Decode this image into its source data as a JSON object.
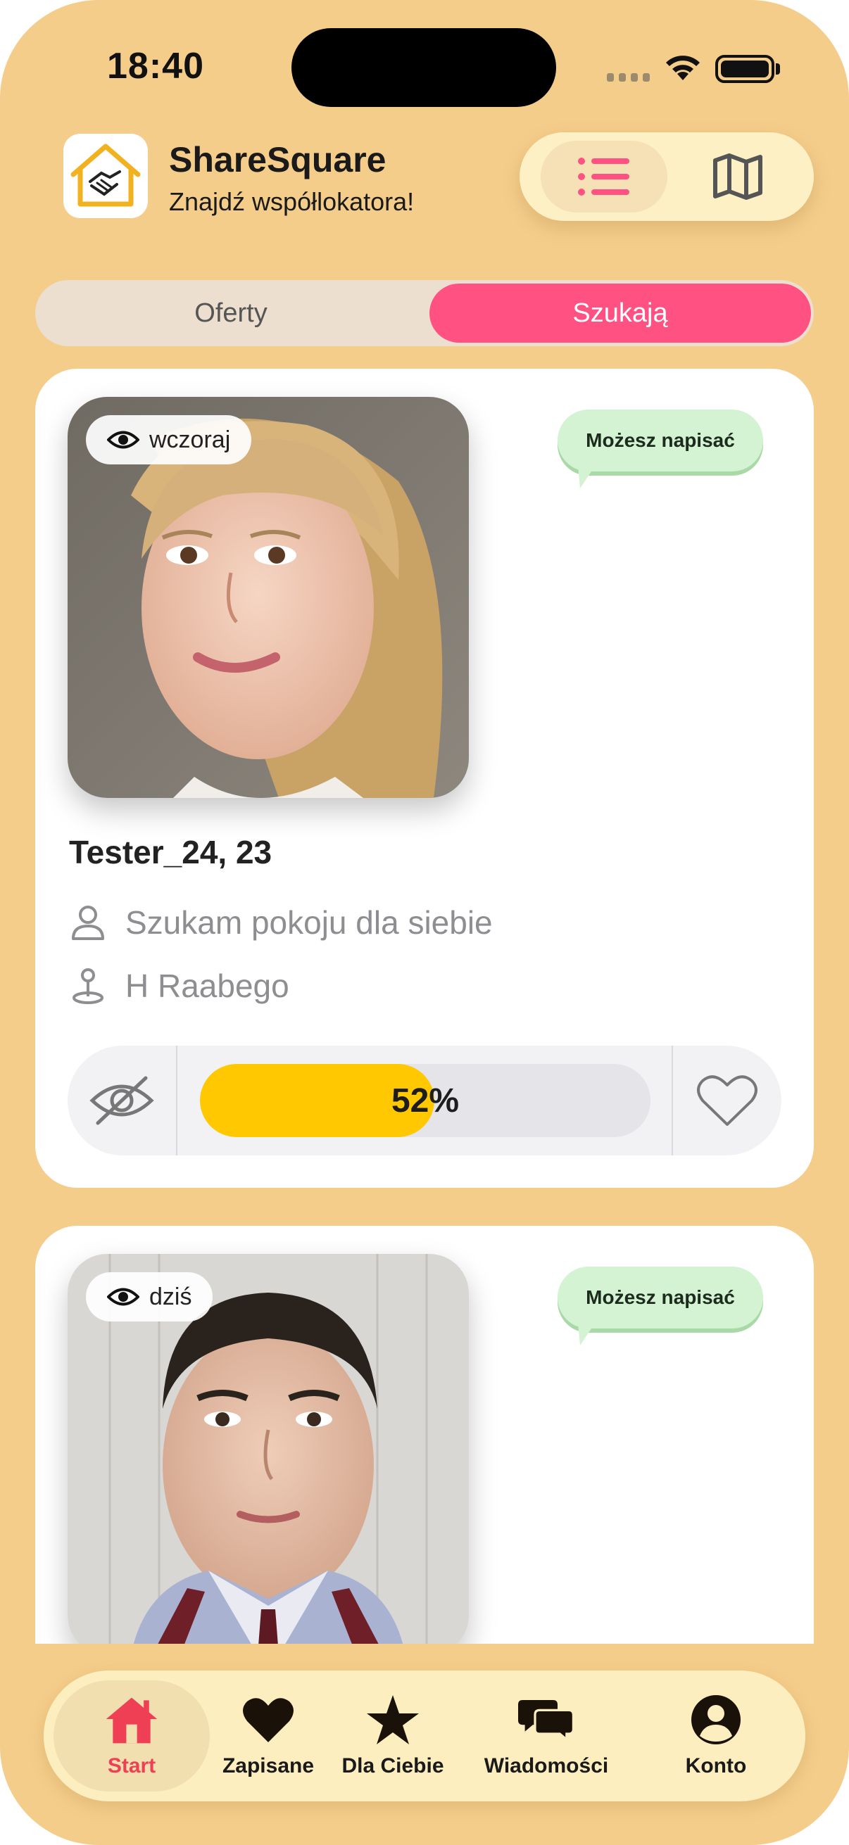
{
  "status_bar": {
    "time": "18:40"
  },
  "header": {
    "app_name": "ShareSquare",
    "tagline": "Znajdź współlokatora!"
  },
  "view_toggle": {
    "list_icon": "list-icon",
    "map_icon": "map-icon",
    "selected": "list"
  },
  "segment": {
    "offers": "Oferty",
    "seeking": "Szukają",
    "selected": "seeking"
  },
  "listings": [
    {
      "seen": "wczoraj",
      "message_badge": "Możesz napisać",
      "name": "Tester_24, 23",
      "looking_for": "Szukam pokoju dla siebie",
      "location": "H Raabego",
      "match_label": "52%",
      "match_value": 0.52
    },
    {
      "seen": "dziś",
      "message_badge": "Możesz napisać"
    }
  ],
  "tabbar": {
    "start": "Start",
    "saved": "Zapisane",
    "for_you": "Dla Ciebie",
    "messages": "Wiadomości",
    "account": "Konto",
    "active": "start",
    "active_color": "#ef3f55"
  },
  "colors": {
    "background": "#f5cd8a",
    "accent_pink": "#ff5283",
    "match_yellow": "#ffc800",
    "bubble_green": "#d4f3d2"
  }
}
